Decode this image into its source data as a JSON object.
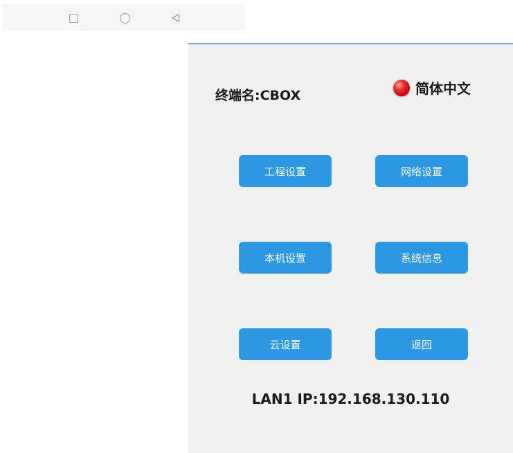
{
  "navbar": {
    "recent_icon": "square-icon",
    "home_icon": "circle-icon",
    "back_icon": "triangle-back-icon"
  },
  "header": {
    "terminal_name_label": "终端名:CBOX",
    "language_label": "简体中文",
    "language_indicator_color": "#d10000"
  },
  "buttons": {
    "project_settings": "工程设置",
    "network_settings": "网络设置",
    "local_settings": "本机设置",
    "system_info": "系统信息",
    "cloud_settings": "云设置",
    "back": "返回"
  },
  "status": {
    "ip_label": "LAN1 IP:192.168.130.110"
  },
  "colors": {
    "button_bg": "#2d97e2",
    "panel_bg": "#f1f1f1",
    "panel_top_border": "#79a8d9"
  }
}
